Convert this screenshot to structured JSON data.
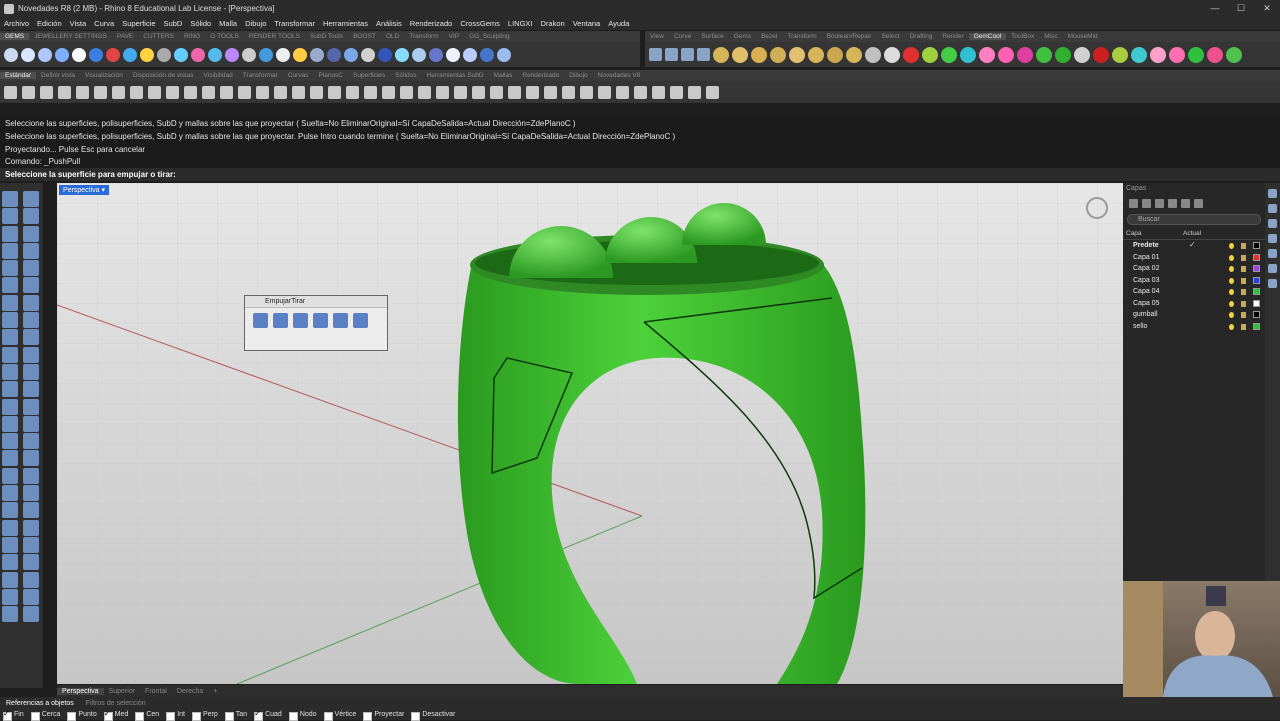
{
  "window": {
    "title": "Novedades R8 (2 MB) - Rhino 8 Educational Lab License - [Perspectiva]",
    "controls": [
      "—",
      "☐",
      "✕"
    ]
  },
  "menu": [
    "Archivo",
    "Edición",
    "Vista",
    "Curva",
    "Superficie",
    "SubD",
    "Sólido",
    "Malla",
    "Dibujo",
    "Transformar",
    "Herramientas",
    "Análisis",
    "Renderizado",
    "CrossGems",
    "LINGXI",
    "Drakon",
    "Ventana",
    "Ayuda"
  ],
  "tabs_left": [
    "GEMS",
    "JEWELLERY SETTINGS",
    "PAVE",
    "CUTTERS",
    "RING",
    "G TOOLS",
    "RENDER TOOLS",
    "SubD Tools",
    "BOOST",
    "OLD",
    "Transform",
    "VIP",
    "GG_Sculpting"
  ],
  "tabs_right": [
    "View",
    "Curve",
    "Surface",
    "Gems",
    "Bezel",
    "Transform",
    "Boolean/Repair",
    "Select",
    "Drafting",
    "Render",
    "GemCool",
    "ToolBox",
    "Misc",
    "MouseMid"
  ],
  "tabs_std": [
    "Estándar",
    "Definir vista",
    "Visualización",
    "Disposición de vistas",
    "Visibilidad",
    "Transformar",
    "Curvas",
    "PlanosC",
    "Superficies",
    "Sólidos",
    "Herramientas SubD",
    "Mallas",
    "Renderizado",
    "Dibujo",
    "Novedades V8"
  ],
  "command_history": [
    "Seleccione las superficies, polisuperficies, SubD y mallas sobre las que proyectar ( Suelta=No  EliminarOriginal=Sí  CapaDeSalida=Actual  Dirección=ZdePlanoC )",
    "Seleccione las superficies, polisuperficies, SubD y mallas sobre las que proyectar. Pulse Intro cuando termine ( Suelta=No  EliminarOriginal=Sí  CapaDeSalida=Actual  Dirección=ZdePlanoC )",
    "Proyectando... Pulse Esc para cancelar",
    "Comando: _PushPull"
  ],
  "prompt": "Seleccione la superficie para empujar o tirar:",
  "viewport": {
    "label": "Perspectiva",
    "label_arrow": "▾"
  },
  "empujar_panel": {
    "title": "EmpujarTirar"
  },
  "viewport_tabs": [
    "Perspectiva",
    "Superior",
    "Frontal",
    "Derecha",
    "+"
  ],
  "osnap_tabs": [
    "Referencias a objetos",
    "Filtros de selección"
  ],
  "osnap_items": [
    {
      "label": "Fin",
      "on": true
    },
    {
      "label": "Cerca",
      "on": false
    },
    {
      "label": "Punto",
      "on": false
    },
    {
      "label": "Med",
      "on": true
    },
    {
      "label": "Cen",
      "on": false
    },
    {
      "label": "Int",
      "on": false
    },
    {
      "label": "Perp",
      "on": false
    },
    {
      "label": "Tan",
      "on": false
    },
    {
      "label": "Cuad",
      "on": true
    },
    {
      "label": "Nodo",
      "on": false
    },
    {
      "label": "Vértice",
      "on": false
    },
    {
      "label": "Proyectar",
      "on": false
    },
    {
      "label": "Desactivar",
      "on": false
    }
  ],
  "layers_panel": {
    "title": "Capas",
    "search_placeholder": "Buscar",
    "col_layer": "Capa",
    "col_current": "Actual",
    "layers": [
      {
        "name": "Predete",
        "current": true,
        "color": "#000000"
      },
      {
        "name": "Capa 01",
        "current": false,
        "color": "#e03030"
      },
      {
        "name": "Capa 02",
        "current": false,
        "color": "#a040e0"
      },
      {
        "name": "Capa 03",
        "current": false,
        "color": "#2040e0"
      },
      {
        "name": "Capa 04",
        "current": false,
        "color": "#30c040"
      },
      {
        "name": "Capa 05",
        "current": false,
        "color": "#ffffff"
      },
      {
        "name": "gumball",
        "current": false,
        "color": "#000000"
      },
      {
        "name": "sello",
        "current": false,
        "color": "#30c040"
      }
    ]
  },
  "colors": {
    "ring": "#3bbf2b",
    "viewport_bg": "#d8d8d8",
    "accent": "#2a6bd8"
  }
}
